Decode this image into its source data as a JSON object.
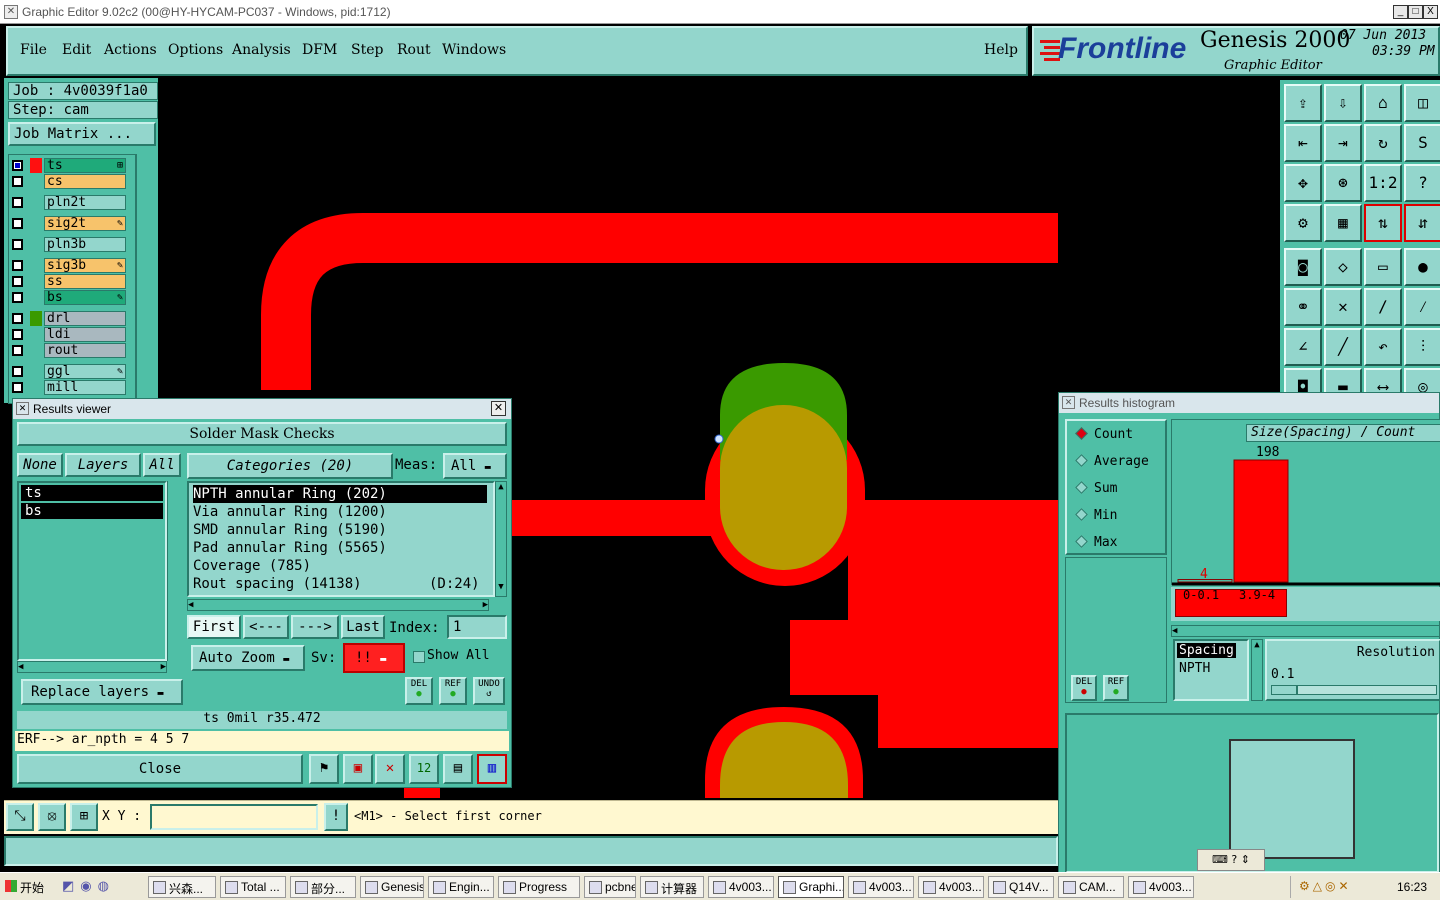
{
  "window": {
    "title": "Graphic Editor 9.02c2 (00@HY-HYCAM-PC037 - Windows, pid:1712)",
    "controls": [
      "_",
      "□",
      "X"
    ]
  },
  "menu": [
    "File",
    "Edit",
    "Actions",
    "Options",
    "Analysis",
    "DFM",
    "Step",
    "Rout",
    "Windows"
  ],
  "help_label": "Help",
  "brand": {
    "logo": "Frontline",
    "product": "Genesis 2000",
    "subtitle": "Graphic Editor",
    "date": "07 Jun 2013",
    "time": "03:39 PM"
  },
  "job": {
    "job_line": "Job : 4v0039f1a0",
    "step_line": "Step: cam",
    "matrix_button": "Job Matrix ..."
  },
  "layers": [
    {
      "name": "ts",
      "color": "#1faa7a",
      "mark": "⊞"
    },
    {
      "name": "cs",
      "color": "#f7c36b",
      "mark": ""
    },
    {
      "name": "pln2t",
      "color": "#93d6cc",
      "mark": ""
    },
    {
      "name": "sig2t",
      "color": "#f7c36b",
      "mark": "✎"
    },
    {
      "name": "pln3b",
      "color": "#93d6cc",
      "mark": ""
    },
    {
      "name": "sig3b",
      "color": "#f7c36b",
      "mark": "✎"
    },
    {
      "name": "ss",
      "color": "#f7c36b",
      "mark": ""
    },
    {
      "name": "bs",
      "color": "#1faa7a",
      "mark": "✎"
    },
    {
      "name": "drl",
      "color": "#a9b8bf",
      "mark": ""
    },
    {
      "name": "ldi",
      "color": "#a9b8bf",
      "mark": ""
    },
    {
      "name": "rout",
      "color": "#a9b8bf",
      "mark": ""
    },
    {
      "name": "ggl",
      "color": "#93d6cc",
      "mark": "✎"
    },
    {
      "name": "mill",
      "color": "#93d6cc",
      "mark": ""
    }
  ],
  "results_viewer": {
    "title": "Results viewer",
    "header": "Solder Mask Checks",
    "none_btn": "None",
    "layers_btn": "Layers",
    "all_btn": "All",
    "categories_btn": "Categories (20)",
    "meas_label": "Meas:",
    "meas_value": "All",
    "layer_list": [
      "ts",
      "bs"
    ],
    "categories": [
      "NPTH annular Ring (202)",
      "Via annular Ring (1200)",
      "SMD annular Ring (5190)",
      "Pad annular Ring (5565)",
      "Coverage (785)",
      "Rout spacing (14138)"
    ],
    "rout_suffix": "(D:24)",
    "first_btn": "First",
    "prev_btn": "<---",
    "next_btn": "--->",
    "last_btn": "Last",
    "index_label": "Index:",
    "index_value": "1",
    "auto_zoom": "Auto Zoom",
    "sv_label": "Sv:",
    "sv_value": "!!",
    "show_all": "Show All",
    "replace_layers": "Replace layers",
    "del_label": "DEL",
    "ref_label": "REF",
    "undo_label": "UNDO",
    "status_line": "ts 0mil  r35.472",
    "erf_line": "ERF--> ar_npth = 4 5 7",
    "close_btn": "Close"
  },
  "histogram": {
    "title": "Results histogram",
    "radios": [
      "Count",
      "Average",
      "Sum",
      "Min",
      "Max"
    ],
    "selected_radio": "Count",
    "axis_label": "Size(Spacing) / Count",
    "chart_data": {
      "type": "bar",
      "categories": [
        "0-0.1",
        "3.9-4"
      ],
      "values": [
        4,
        198
      ],
      "ylim": [
        0,
        198
      ],
      "bar_color": "#ff0000"
    },
    "spacing_list": [
      "Spacing",
      "NPTH"
    ],
    "resolution_label": "Resolution",
    "resolution_value": "0.1",
    "del_label": "DEL",
    "ref_label": "REF"
  },
  "command_bar": {
    "xy_label": "X Y :",
    "xy_value": "",
    "prompt": "<M1> - Select first corner"
  },
  "taskbar": {
    "start": "开始",
    "tasks": [
      "兴森...",
      "Total ...",
      "部分...",
      "Genesis",
      "Engin...",
      "Progress",
      "pcbne...",
      "计算器",
      "4v003...",
      "Graphi...",
      "4v003...",
      "4v003...",
      "Q14V...",
      "CAM...",
      "4v003..."
    ],
    "active_task": "Graphi...",
    "clock": "16:23"
  },
  "colors": {
    "panel_teal": "#4fbfa6",
    "panel_light": "#93d6cc",
    "trace_red": "#ff0000",
    "pad_green": "#3a9a00",
    "pad_olive": "#b89a00"
  }
}
